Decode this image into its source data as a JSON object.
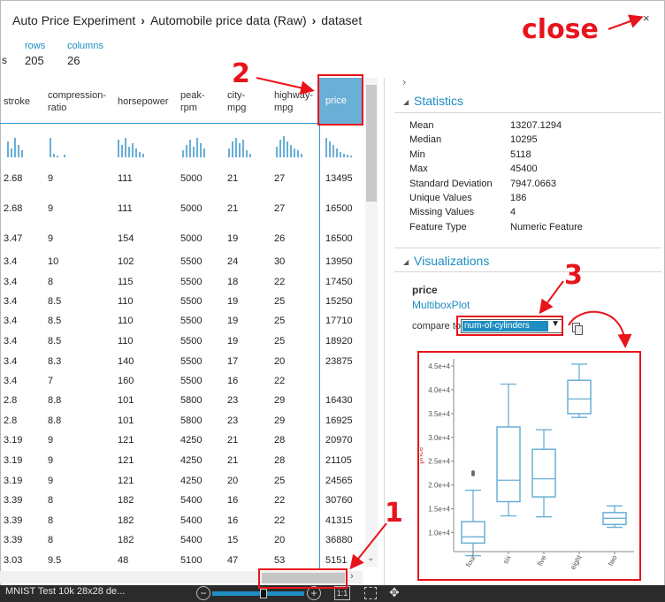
{
  "breadcrumb": [
    "Auto Price Experiment",
    "Automobile price data (Raw)",
    "dataset"
  ],
  "close_icon": "×",
  "summary": {
    "rows_label": "rows",
    "rows_value": "205",
    "columns_label": "columns",
    "columns_value": "26",
    "left_fragment": "s"
  },
  "table": {
    "headers": [
      "stroke",
      "compression-ratio",
      "horsepower",
      "peak-rpm",
      "city-mpg",
      "highway-mpg",
      "price"
    ],
    "rows": [
      [
        "2.68",
        "9",
        "111",
        "5000",
        "21",
        "27",
        "13495"
      ],
      [
        "2.68",
        "9",
        "111",
        "5000",
        "21",
        "27",
        "16500"
      ],
      [
        "3.47",
        "9",
        "154",
        "5000",
        "19",
        "26",
        "16500"
      ],
      [
        "3.4",
        "10",
        "102",
        "5500",
        "24",
        "30",
        "13950"
      ],
      [
        "3.4",
        "8",
        "115",
        "5500",
        "18",
        "22",
        "17450"
      ],
      [
        "3.4",
        "8.5",
        "110",
        "5500",
        "19",
        "25",
        "15250"
      ],
      [
        "3.4",
        "8.5",
        "110",
        "5500",
        "19",
        "25",
        "17710"
      ],
      [
        "3.4",
        "8.5",
        "110",
        "5500",
        "19",
        "25",
        "18920"
      ],
      [
        "3.4",
        "8.3",
        "140",
        "5500",
        "17",
        "20",
        "23875"
      ],
      [
        "3.4",
        "7",
        "160",
        "5500",
        "16",
        "22",
        ""
      ],
      [
        "2.8",
        "8.8",
        "101",
        "5800",
        "23",
        "29",
        "16430"
      ],
      [
        "2.8",
        "8.8",
        "101",
        "5800",
        "23",
        "29",
        "16925"
      ],
      [
        "3.19",
        "9",
        "121",
        "4250",
        "21",
        "28",
        "20970"
      ],
      [
        "3.19",
        "9",
        "121",
        "4250",
        "21",
        "28",
        "21105"
      ],
      [
        "3.19",
        "9",
        "121",
        "4250",
        "20",
        "25",
        "24565"
      ],
      [
        "3.39",
        "8",
        "182",
        "5400",
        "16",
        "22",
        "30760"
      ],
      [
        "3.39",
        "8",
        "182",
        "5400",
        "16",
        "22",
        "41315"
      ],
      [
        "3.39",
        "8",
        "182",
        "5400",
        "15",
        "20",
        "36880"
      ],
      [
        "3.03",
        "9.5",
        "48",
        "5100",
        "47",
        "53",
        "5151"
      ]
    ]
  },
  "panel": {
    "statistics_title": "Statistics",
    "stats": [
      [
        "Mean",
        "13207.1294"
      ],
      [
        "Median",
        "10295"
      ],
      [
        "Min",
        "5118"
      ],
      [
        "Max",
        "45400"
      ],
      [
        "Standard Deviation",
        "7947.0663"
      ],
      [
        "Unique Values",
        "186"
      ],
      [
        "Missing Values",
        "4"
      ],
      [
        "Feature Type",
        "Numeric Feature"
      ]
    ],
    "visualizations_title": "Visualizations",
    "feature_name": "price",
    "plot_link": "MultiboxPlot",
    "compare_label": "compare to",
    "compare_value": "num-of-cylinders"
  },
  "chart_data": {
    "type": "box",
    "ylabel": "price",
    "yticks": [
      "1.0e+4",
      "1.5e+4",
      "2.0e+4",
      "2.5e+4",
      "3.0e+4",
      "3.5e+4",
      "4.0e+4",
      "4.5e+4"
    ],
    "ylim": [
      6000,
      46500
    ],
    "categories": [
      "four",
      "six",
      "five",
      "eight",
      "two"
    ],
    "boxes": [
      {
        "min": 5150,
        "q1": 7800,
        "median": 9100,
        "q3": 12300,
        "max": 18900,
        "outliers": [
          22200,
          22700
        ]
      },
      {
        "min": 13500,
        "q1": 16500,
        "median": 21000,
        "q3": 32200,
        "max": 41200,
        "outliers": []
      },
      {
        "min": 13300,
        "q1": 17500,
        "median": 21300,
        "q3": 27500,
        "max": 31600,
        "outliers": []
      },
      {
        "min": 34200,
        "q1": 35000,
        "median": 38100,
        "q3": 42000,
        "max": 45400,
        "outliers": []
      },
      {
        "min": 11100,
        "q1": 11700,
        "median": 13000,
        "q3": 14200,
        "max": 15600,
        "outliers": []
      }
    ]
  },
  "bottombar": {
    "text": "MNIST Test 10k 28x28 de...",
    "zoom_minus": "−",
    "zoom_plus": "+",
    "actual_size": "1:1",
    "pan_icon": "✥"
  },
  "annotations": {
    "close": "close",
    "n1": "1",
    "n2": "2",
    "n3": "3"
  },
  "colors": {
    "accent": "#1e8ec2",
    "bar": "#6aafd6",
    "annotation": "#e8141b"
  }
}
